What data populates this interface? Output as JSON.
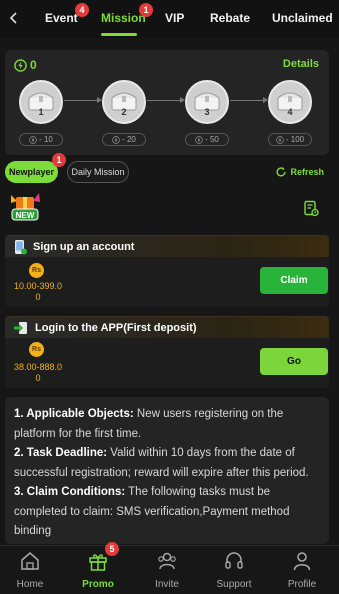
{
  "tabs": [
    {
      "label": "Event",
      "badge": "4"
    },
    {
      "label": "Mission",
      "badge": "1",
      "active": true
    },
    {
      "label": "VIP"
    },
    {
      "label": "Rebate"
    },
    {
      "label": "Unclaimed"
    }
  ],
  "chests": {
    "bolt_count": "0",
    "details_label": "Details",
    "nodes": [
      {
        "number": "1",
        "cost": "- 10"
      },
      {
        "number": "2",
        "cost": "- 20"
      },
      {
        "number": "3",
        "cost": "- 50"
      },
      {
        "number": "4",
        "cost": "- 100"
      }
    ]
  },
  "subtabs": {
    "newplayer": "Newplayer",
    "newplayer_badge": "1",
    "daily": "Daily Mission",
    "refresh": "Refresh"
  },
  "new_icon_text": "NEW",
  "tasks": [
    {
      "title": "Sign up an account",
      "coin": "Rs",
      "reward_line1": "10.00-399.0",
      "reward_line2": "0",
      "button": "Claim"
    },
    {
      "title": "Login to the APP(First deposit)",
      "coin": "Rs",
      "reward_line1": "38.00-888.0",
      "reward_line2": "0",
      "button": "Go"
    }
  ],
  "rules": {
    "r1_head": "1. Applicable Objects:",
    "r1_body": " New users registering on the platform for the first time.",
    "r2_head": "2. Task Deadline:",
    "r2_body": " Valid within 10 days from the date of successful registration; reward will expire after this period.",
    "r3_head": "3. Claim Conditions:",
    "r3_body": " The following tasks must be completed to claim: SMS verification,Payment method binding"
  },
  "nav": [
    {
      "label": "Home"
    },
    {
      "label": "Promo",
      "badge": "5",
      "active": true
    },
    {
      "label": "Invite"
    },
    {
      "label": "Support"
    },
    {
      "label": "Profile"
    }
  ],
  "colors": {
    "accent": "#7ddc3a",
    "claim": "#28b43a",
    "coin": "#f2b019",
    "badge": "#e23b3b"
  }
}
